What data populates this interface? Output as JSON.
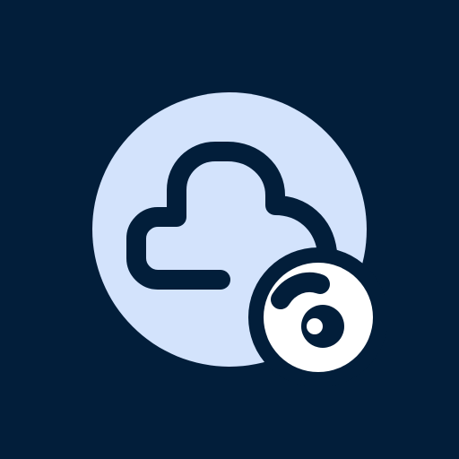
{
  "icon": {
    "name": "cloud-eye-app-icon",
    "parts": [
      "cloud-icon",
      "eye-icon"
    ]
  },
  "colors": {
    "background": "#021e3a",
    "circle_fill": "#d3e3fc",
    "stroke": "#021e3a",
    "badge_fill": "#ffffff"
  }
}
